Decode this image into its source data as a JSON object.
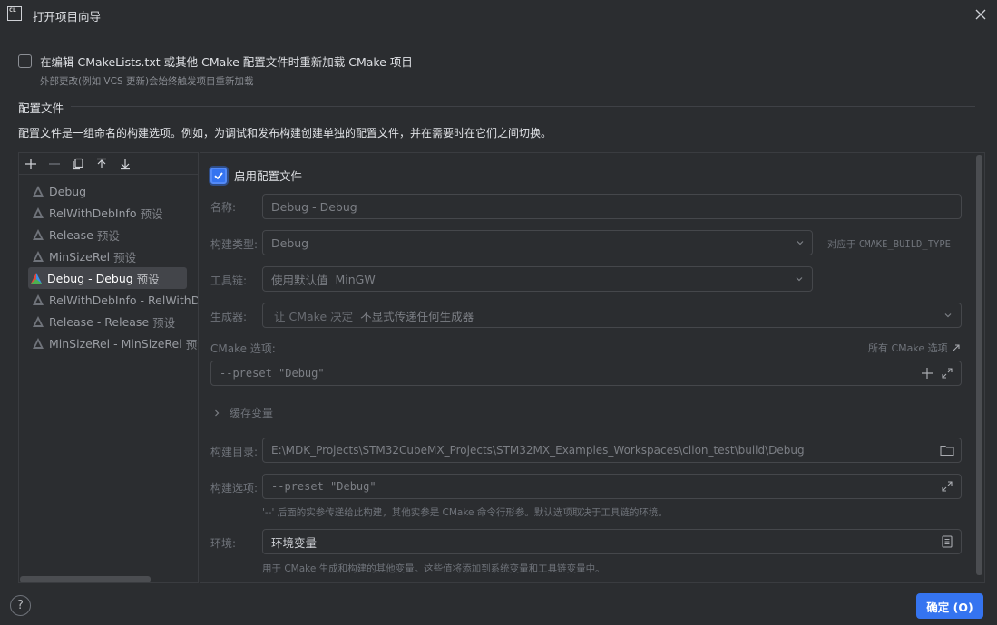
{
  "window": {
    "title": "打开项目向导",
    "logo_text": "CL"
  },
  "reload": {
    "label": "在编辑 CMakeLists.txt 或其他 CMake 配置文件时重新加载 CMake 项目",
    "hint": "外部更改(例如 VCS 更新)会始终触发项目重新加载",
    "checked": false
  },
  "section": {
    "title": "配置文件",
    "description": "配置文件是一组命名的构建选项。例如，为调试和发布构建创建单独的配置文件，并在需要时在它们之间切换。"
  },
  "toolbar": {
    "icons": [
      "plus-icon",
      "minus-icon",
      "copy-icon",
      "move-up-icon",
      "move-down-icon"
    ]
  },
  "profiles": [
    {
      "name": "Debug",
      "tag": "",
      "selected": false
    },
    {
      "name": "RelWithDebInfo",
      "tag": "预设",
      "selected": false
    },
    {
      "name": "Release",
      "tag": "预设",
      "selected": false
    },
    {
      "name": "MinSizeRel",
      "tag": "预设",
      "selected": false
    },
    {
      "name": "Debug - Debug",
      "tag": "预设",
      "selected": true
    },
    {
      "name": "RelWithDebInfo - RelWithDe",
      "tag": "",
      "selected": false
    },
    {
      "name": "Release - Release",
      "tag": "预设",
      "selected": false
    },
    {
      "name": "MinSizeRel - MinSizeRel",
      "tag": "预设",
      "selected": false
    }
  ],
  "form": {
    "enable_label": "启用配置文件",
    "enable_checked": true,
    "name_label": "名称:",
    "name_value": "Debug - Debug",
    "build_type_label": "构建类型:",
    "build_type_value": "Debug",
    "build_type_note_prefix": "对应于",
    "build_type_note_var": "CMAKE_BUILD_TYPE",
    "toolchain_label": "工具链:",
    "toolchain_prefix": "使用默认值",
    "toolchain_value": "MinGW",
    "generator_label": "生成器:",
    "generator_prefix": "让 CMake 决定",
    "generator_value": "不显式传递任何生成器",
    "cmake_options_label": "CMake 选项:",
    "all_cmake_options_link": "所有 CMake 选项",
    "cmake_options_value": "--preset \"Debug\"",
    "cache_vars_label": "缓存变量",
    "build_dir_label": "构建目录:",
    "build_dir_value": "E:\\MDK_Projects\\STM32CubeMX_Projects\\STM32MX_Examples_Workspaces\\clion_test\\build\\Debug",
    "build_options_label": "构建选项:",
    "build_options_value": "--preset \"Debug\"",
    "build_options_hint": "'--' 后面的实参传递给此构建，其他实参是 CMake 命令行形参。默认选项取决于工具链的环境。",
    "env_label": "环境:",
    "env_value": "环境变量",
    "env_hint": "用于 CMake 生成和构建的其他变量。这些值将添加到系统变量和工具链变量中。"
  },
  "footer": {
    "help_label": "?",
    "ok_label": "确定 (O)"
  },
  "colors": {
    "accent": "#3574f0",
    "background": "#2b2d30",
    "selected_row": "#43454a"
  }
}
